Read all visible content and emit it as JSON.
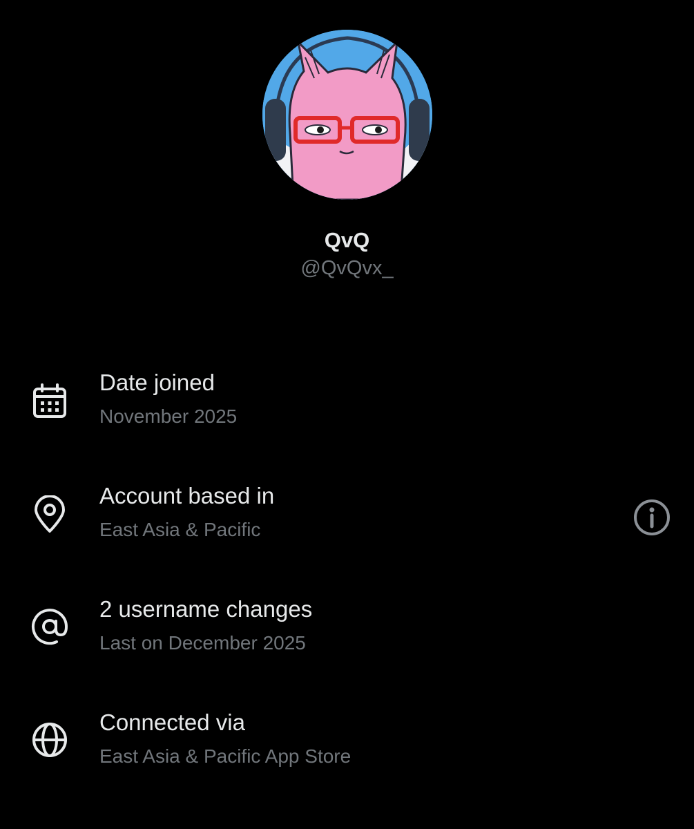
{
  "profile": {
    "display_name": "QvQ",
    "handle": "@QvQvx_",
    "avatar_icon": "pink-cat-with-red-glasses-avatar"
  },
  "details": [
    {
      "icon": "calendar-icon",
      "title": "Date joined",
      "value": "November 2025"
    },
    {
      "icon": "location-pin-icon",
      "title": "Account based in",
      "value": "East Asia & Pacific",
      "action_icon": "info-icon"
    },
    {
      "icon": "at-sign-icon",
      "title": "2 username changes",
      "value": "Last on December 2025"
    },
    {
      "icon": "globe-icon",
      "title": "Connected via",
      "value": "East Asia & Pacific App Store"
    }
  ],
  "colors": {
    "background": "#000000",
    "primary_text": "#e7e9ea",
    "secondary_text": "#71767b",
    "info_icon": "#8b9096"
  }
}
